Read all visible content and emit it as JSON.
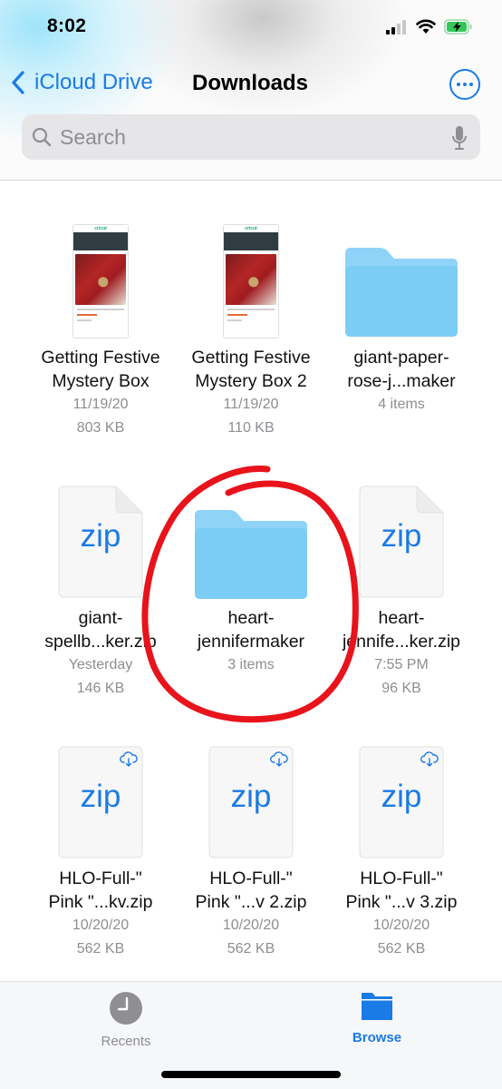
{
  "status_bar": {
    "time": "8:02",
    "signal_bars": 2,
    "signal_bars_total": 4,
    "battery_charging": true,
    "battery_color": "#34c759"
  },
  "nav": {
    "back_label": "iCloud Drive",
    "title": "Downloads",
    "more_icon": "ellipsis-circle-icon",
    "accent_color": "#1a7ae6"
  },
  "search": {
    "placeholder": "Search",
    "value": ""
  },
  "items": [
    {
      "type": "document",
      "name_line1": "Getting Festive",
      "name_line2": "Mystery Box",
      "meta1": "11/19/20",
      "meta2": "803 KB",
      "thumb_brand": "cricut"
    },
    {
      "type": "document",
      "name_line1": "Getting Festive",
      "name_line2": "Mystery Box 2",
      "meta1": "11/19/20",
      "meta2": "110 KB",
      "thumb_brand": "cricut"
    },
    {
      "type": "folder",
      "name_line1": "giant-paper-",
      "name_line2": "rose-j...maker",
      "meta1": "4 items",
      "meta2": ""
    },
    {
      "type": "zip",
      "icon_label": "zip",
      "name_line1": "giant-",
      "name_line2": "spellb...ker.zip",
      "meta1": "Yesterday",
      "meta2": "146 KB",
      "in_cloud": false
    },
    {
      "type": "folder",
      "name_line1": "heart-",
      "name_line2": "jennifermaker",
      "meta1": "3 items",
      "meta2": "",
      "annotated": true
    },
    {
      "type": "zip",
      "icon_label": "zip",
      "name_line1": "heart-",
      "name_line2": "jennife...ker.zip",
      "meta1": "7:55 PM",
      "meta2": "96 KB",
      "in_cloud": false
    },
    {
      "type": "zip",
      "icon_label": "zip",
      "name_line1": "HLO-Full-\"",
      "name_line2": "Pink \"...kv.zip",
      "meta1": "10/20/20",
      "meta2": "562 KB",
      "in_cloud": true
    },
    {
      "type": "zip",
      "icon_label": "zip",
      "name_line1": "HLO-Full-\"",
      "name_line2": "Pink \"...v 2.zip",
      "meta1": "10/20/20",
      "meta2": "562 KB",
      "in_cloud": true
    },
    {
      "type": "zip",
      "icon_label": "zip",
      "name_line1": "HLO-Full-\"",
      "name_line2": "Pink \"...v 3.zip",
      "meta1": "10/20/20",
      "meta2": "562 KB",
      "in_cloud": true
    }
  ],
  "annotation": {
    "shape": "hand-drawn circle",
    "color": "#e8131b",
    "target": "heart-jennifermaker"
  },
  "tab_bar": {
    "tabs": [
      {
        "label": "Recents",
        "icon": "clock-icon",
        "active": false
      },
      {
        "label": "Browse",
        "icon": "folder-icon",
        "active": true
      }
    ]
  }
}
